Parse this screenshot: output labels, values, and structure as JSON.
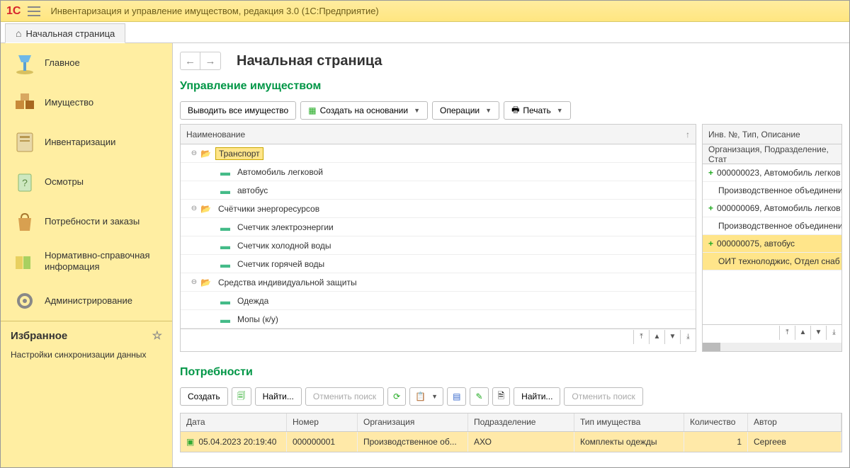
{
  "app": {
    "logo": "1C",
    "title": "Инвентаризация и управление имуществом, редакция 3.0  (1С:Предприятие)"
  },
  "tabs": [
    {
      "label": "Начальная страница"
    }
  ],
  "sidebar": {
    "items": [
      {
        "label": "Главное"
      },
      {
        "label": "Имущество"
      },
      {
        "label": "Инвентаризации"
      },
      {
        "label": "Осмотры"
      },
      {
        "label": "Потребности и заказы"
      },
      {
        "label": "Нормативно-справочная информация"
      },
      {
        "label": "Администрирование"
      }
    ],
    "favorites_title": "Избранное",
    "favorites_sub": "Настройки синхронизации данных"
  },
  "page": {
    "title": "Начальная страница"
  },
  "section1": {
    "title": "Управление имуществом",
    "btn_all": "Выводить все имущество",
    "btn_create": "Создать на основании",
    "btn_ops": "Операции",
    "btn_print": "Печать",
    "left_header": "Наименование",
    "right_header1": "Инв. №, Тип, Описание",
    "right_header2": "Организация, Подразделение, Стат",
    "tree": [
      {
        "level": 0,
        "kind": "folder",
        "open": true,
        "label": "Транспорт",
        "selected": true
      },
      {
        "level": 1,
        "kind": "item",
        "label": "Автомобиль легковой"
      },
      {
        "level": 1,
        "kind": "item",
        "label": "автобус"
      },
      {
        "level": 0,
        "kind": "folder",
        "open": true,
        "label": "Счётчики энергоресурсов"
      },
      {
        "level": 1,
        "kind": "item",
        "label": "Счетчик электроэнергии"
      },
      {
        "level": 1,
        "kind": "item",
        "label": "Счетчик холодной воды"
      },
      {
        "level": 1,
        "kind": "item",
        "label": "Счетчик горячей воды"
      },
      {
        "level": 0,
        "kind": "folder",
        "open": true,
        "label": "Средства индивидуальной защиты"
      },
      {
        "level": 1,
        "kind": "item",
        "label": "Одежда"
      },
      {
        "level": 1,
        "kind": "item",
        "label": "Мопы (к/у)"
      }
    ],
    "right_rows": [
      {
        "line1": "000000023, Автомобиль легков",
        "line2": "Производственное объединени",
        "plus": true
      },
      {
        "line1": "000000069, Автомобиль легков",
        "line2": "Производственное объединени",
        "plus": true
      },
      {
        "line1": "000000075, автобус",
        "line2": "ОИТ технолоджис, Отдел снаб",
        "plus": true,
        "selected": true
      }
    ]
  },
  "section2": {
    "title": "Потребности",
    "btn_create": "Создать",
    "btn_find1": "Найти...",
    "btn_cancel1": "Отменить поиск",
    "btn_find2": "Найти...",
    "btn_cancel2": "Отменить поиск",
    "columns": {
      "date": "Дата",
      "num": "Номер",
      "org": "Организация",
      "dept": "Подразделение",
      "type": "Тип имущества",
      "qty": "Количество",
      "author": "Автор"
    },
    "rows": [
      {
        "date": "05.04.2023 20:19:40",
        "num": "000000001",
        "org": "Производственное об...",
        "dept": "АХО",
        "type": "Комплекты одежды",
        "qty": "1",
        "author": "Сергеев"
      }
    ]
  }
}
